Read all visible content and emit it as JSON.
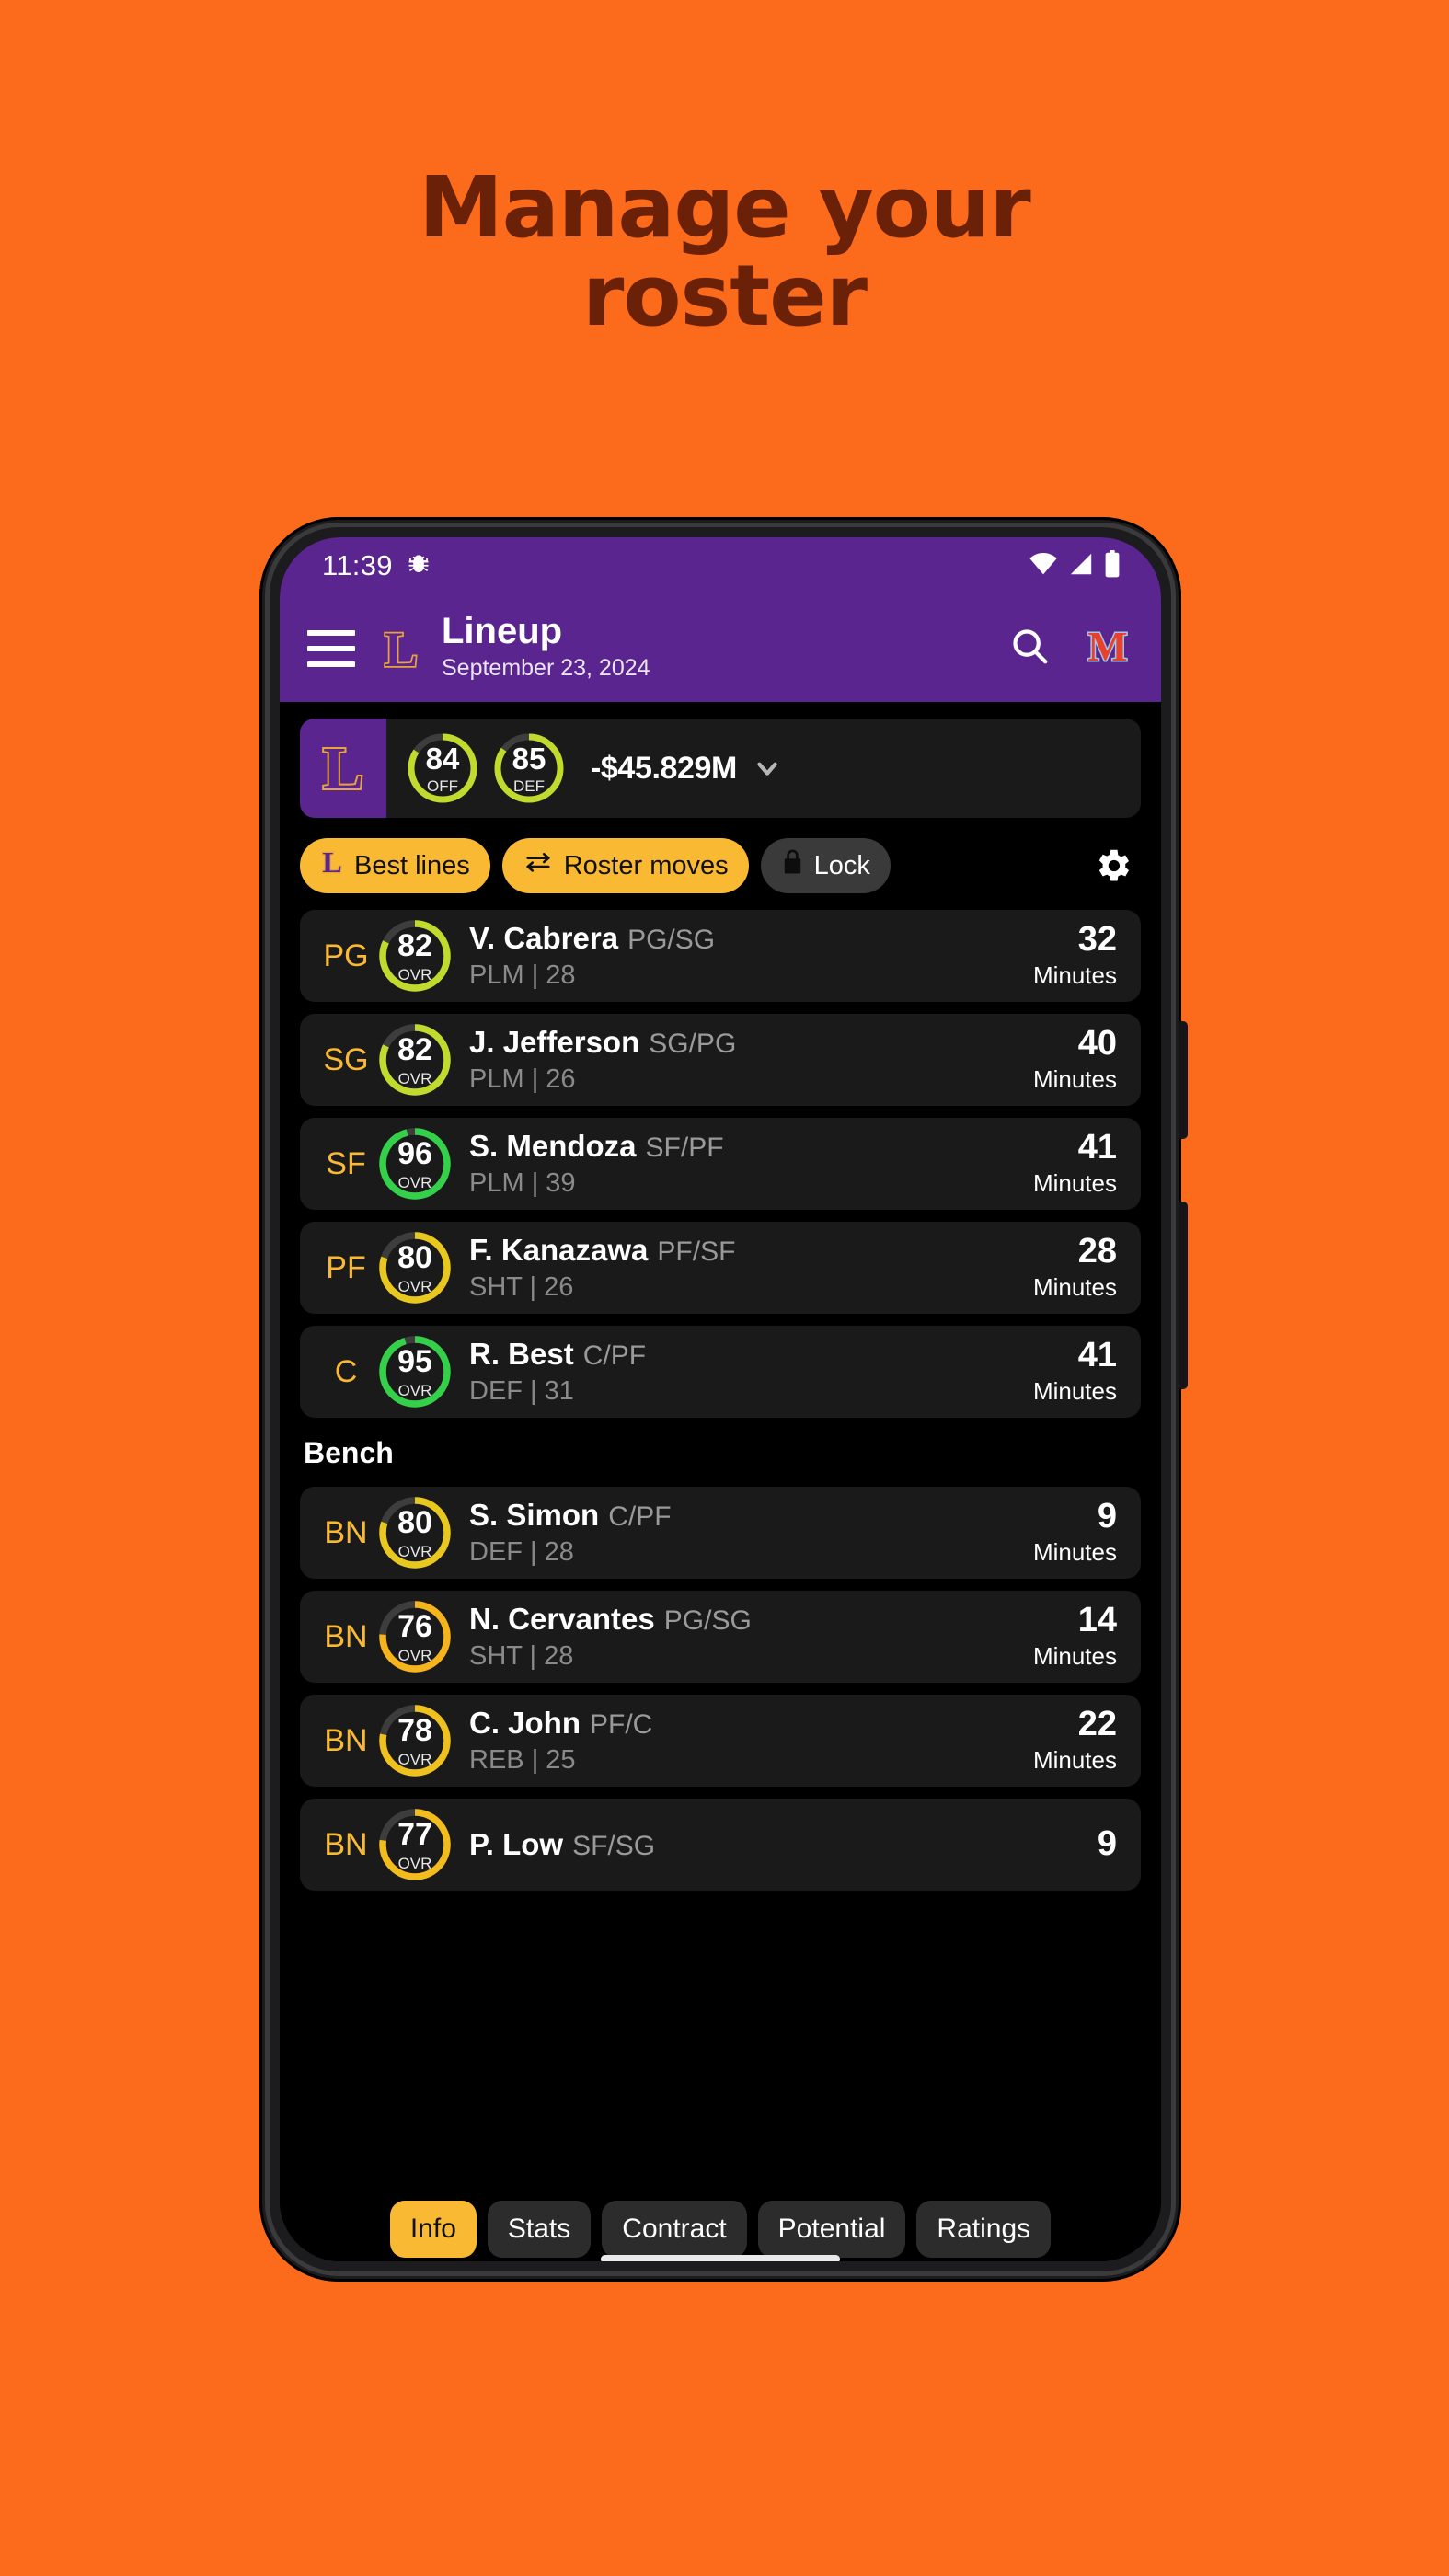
{
  "promo": {
    "headline": "Manage your\nroster",
    "background_color": "#FC6A1B",
    "headline_color": "#6B2108"
  },
  "status_bar": {
    "time": "11:39",
    "debug_icon": "bug-icon",
    "icons": [
      "wifi-icon",
      "cellular-signal-icon",
      "battery-icon"
    ]
  },
  "app_bar": {
    "menu_icon": "hamburger-menu-icon",
    "team_logo": "L",
    "title": "Lineup",
    "subtitle": "September 23, 2024",
    "search_icon": "search-icon",
    "opponent_logo": "M",
    "background_color": "#5B2590"
  },
  "team_bar": {
    "logo": "L",
    "gauges": [
      {
        "value": "84",
        "label": "OFF",
        "pct": 84,
        "color": "#C2D92E"
      },
      {
        "value": "85",
        "label": "DEF",
        "pct": 85,
        "color": "#C2D92E"
      }
    ],
    "cap_space": "-$45.829M",
    "chevron_icon": "chevron-down-icon"
  },
  "actions": [
    {
      "label": "Best lines",
      "icon": "team-l-logo-icon",
      "style": "amber"
    },
    {
      "label": "Roster moves",
      "icon": "swap-arrows-icon",
      "style": "amber"
    },
    {
      "label": "Lock",
      "icon": "lock-icon",
      "style": "dark"
    }
  ],
  "settings_icon": "gear-icon",
  "starters": [
    {
      "pos": "PG",
      "ovr": "82",
      "pct": 82,
      "ring": "#C2D92E",
      "name": "V. Cabrera",
      "positions": "PG/SG",
      "archetype": "PLM",
      "age": "28",
      "minutes": "32",
      "minutes_label": "Minutes"
    },
    {
      "pos": "SG",
      "ovr": "82",
      "pct": 82,
      "ring": "#C2D92E",
      "name": "J. Jefferson",
      "positions": "SG/PG",
      "archetype": "PLM",
      "age": "26",
      "minutes": "40",
      "minutes_label": "Minutes"
    },
    {
      "pos": "SF",
      "ovr": "96",
      "pct": 96,
      "ring": "#35D04A",
      "name": "S. Mendoza",
      "positions": "SF/PF",
      "archetype": "PLM",
      "age": "39",
      "minutes": "41",
      "minutes_label": "Minutes"
    },
    {
      "pos": "PF",
      "ovr": "80",
      "pct": 80,
      "ring": "#E8C81E",
      "name": "F. Kanazawa",
      "positions": "PF/SF",
      "archetype": "SHT",
      "age": "26",
      "minutes": "28",
      "minutes_label": "Minutes"
    },
    {
      "pos": "C",
      "ovr": "95",
      "pct": 95,
      "ring": "#35D04A",
      "name": "R. Best",
      "positions": "C/PF",
      "archetype": "DEF",
      "age": "31",
      "minutes": "41",
      "minutes_label": "Minutes"
    }
  ],
  "bench_title": "Bench",
  "bench": [
    {
      "pos": "BN",
      "ovr": "80",
      "pct": 80,
      "ring": "#E8C81E",
      "name": "S. Simon",
      "positions": "C/PF",
      "archetype": "DEF",
      "age": "28",
      "minutes": "9",
      "minutes_label": "Minutes"
    },
    {
      "pos": "BN",
      "ovr": "76",
      "pct": 76,
      "ring": "#F5B31C",
      "name": "N. Cervantes",
      "positions": "PG/SG",
      "archetype": "SHT",
      "age": "28",
      "minutes": "14",
      "minutes_label": "Minutes"
    },
    {
      "pos": "BN",
      "ovr": "78",
      "pct": 78,
      "ring": "#EFC11E",
      "name": "C. John",
      "positions": "PF/C",
      "archetype": "REB",
      "age": "25",
      "minutes": "22",
      "minutes_label": "Minutes"
    },
    {
      "pos": "BN",
      "ovr": "77",
      "pct": 77,
      "ring": "#F2BC1C",
      "name": "P. Low",
      "positions": "SF/SG",
      "archetype": "",
      "age": "",
      "minutes": "9",
      "minutes_label": ""
    }
  ],
  "tabs": [
    {
      "label": "Info",
      "active": true
    },
    {
      "label": "Stats",
      "active": false
    },
    {
      "label": "Contract",
      "active": false
    },
    {
      "label": "Potential",
      "active": false
    },
    {
      "label": "Ratings",
      "active": false
    }
  ],
  "colors": {
    "accent_amber": "#F9B933",
    "purple": "#5B2590",
    "gold": "#E8A33D",
    "card": "#1a1a1a"
  }
}
